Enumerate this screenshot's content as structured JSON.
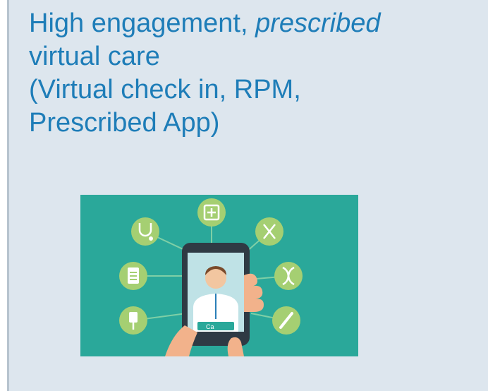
{
  "slide": {
    "heading": {
      "line1_prefix": "High engagement, ",
      "line1_emphasis": "prescribed",
      "line2": "virtual care",
      "line3": "(Virtual check in, RPM,",
      "line4": "Prescribed App)"
    },
    "illustration": {
      "button_text": "Ca",
      "colors": {
        "background": "#2aa89a",
        "circle": "#a5cf72",
        "phone": "#2f3a44",
        "hand": "#f2b28b",
        "screen": "#bfe2e6"
      }
    }
  }
}
